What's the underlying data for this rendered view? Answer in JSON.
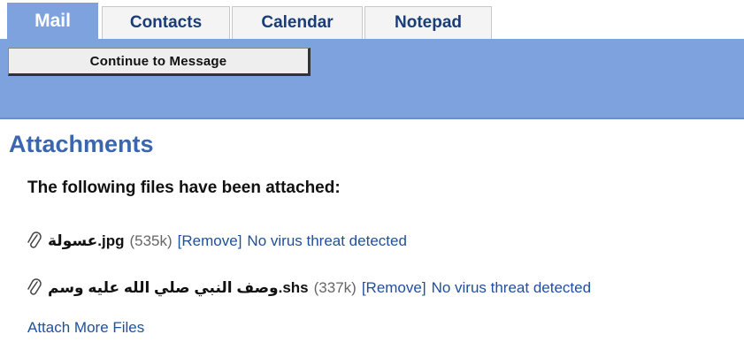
{
  "tabs": [
    {
      "label": "Mail",
      "active": true
    },
    {
      "label": "Contacts",
      "active": false
    },
    {
      "label": "Calendar",
      "active": false
    },
    {
      "label": "Notepad",
      "active": false
    }
  ],
  "toolbar": {
    "continue_label": "Continue to Message"
  },
  "page": {
    "title": "Attachments",
    "subtitle": "The following files have been attached:"
  },
  "attachments": [
    {
      "name": "عسولة.jpg",
      "size": "(535k)",
      "remove_label": "[Remove]",
      "status": "No virus threat detected",
      "icon": "paperclip-icon"
    },
    {
      "name": "وصف النبي صلي الله عليه وسم.shs",
      "size": "(337k)",
      "remove_label": "[Remove]",
      "status": "No virus threat detected",
      "icon": "paperclip-icon"
    }
  ],
  "attach_more_label": "Attach More Files",
  "colors": {
    "accent": "#7ea2de",
    "title": "#3a66b0",
    "link": "#1f4f9f"
  }
}
